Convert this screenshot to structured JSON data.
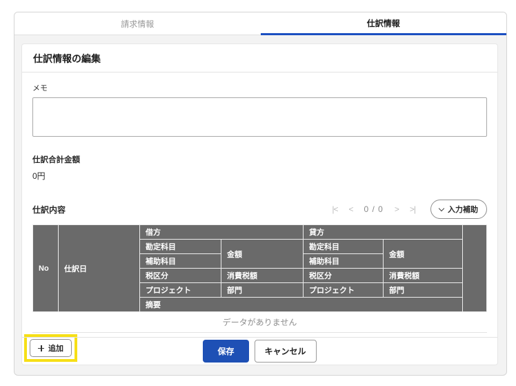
{
  "tabs": [
    {
      "label": "請求情報",
      "active": false
    },
    {
      "label": "仕訳情報",
      "active": true
    }
  ],
  "panel": {
    "title": "仕訳情報の編集"
  },
  "memo": {
    "label": "メモ",
    "value": ""
  },
  "total": {
    "label": "仕訳合計金額",
    "value": "0円"
  },
  "journal": {
    "label": "仕訳内容",
    "pagination": {
      "first_icon": "|<",
      "prev_icon": "<",
      "counter": "0 / 0",
      "next_icon": ">",
      "last_icon": ">|"
    },
    "assist_button": {
      "label": "入力補助",
      "icon": "chevron-down-icon"
    },
    "table": {
      "headers": {
        "no": "No",
        "date": "仕訳日",
        "debit": "借方",
        "credit": "貸方",
        "account": "勘定科目",
        "amount": "金額",
        "sub_account": "補助科目",
        "tax_class": "税区分",
        "tax_amount": "消費税額",
        "project": "プロジェクト",
        "department": "部門",
        "summary": "摘要"
      },
      "empty_message": "データがありません"
    },
    "add_button": {
      "label": "追加",
      "icon": "plus-icon"
    }
  },
  "footer": {
    "save_label": "保存",
    "cancel_label": "キャンセル"
  },
  "colors": {
    "accent_blue": "#1b4fc1",
    "save_blue": "#1e50b5",
    "table_header_gray": "#6a6a6a",
    "highlight_yellow": "#f6df17"
  }
}
